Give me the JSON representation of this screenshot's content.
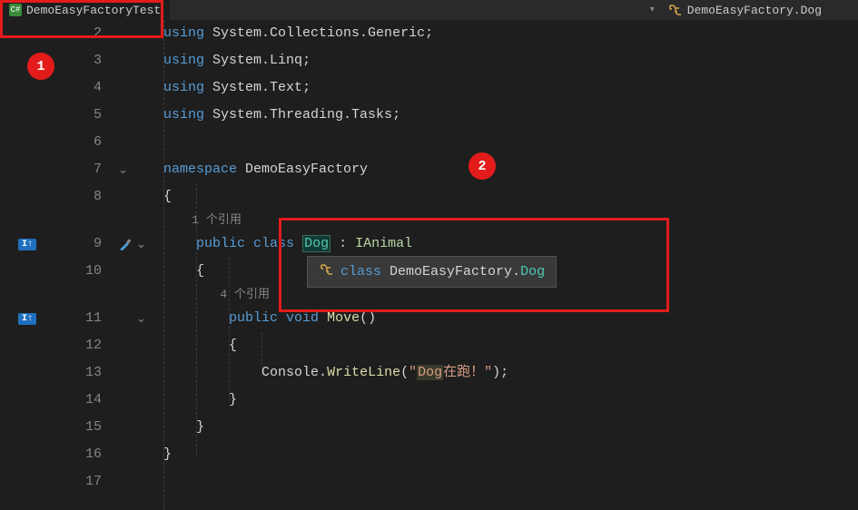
{
  "tab": {
    "icon_text": "C#",
    "title": "DemoEasyFactoryTest"
  },
  "breadcrumb": {
    "text": "DemoEasyFactory.Dog"
  },
  "line_numbers": [
    "2",
    "3",
    "4",
    "5",
    "6",
    "7",
    "8",
    "",
    "9",
    "10",
    "",
    "11",
    "12",
    "13",
    "14",
    "15",
    "16",
    "17"
  ],
  "code": {
    "using_kw": "using",
    "ns1": "System.Collections.Generic",
    "ns2": "System.Linq",
    "ns3": "System.Text",
    "ns4": "System.Threading.Tasks",
    "namespace_kw": "namespace",
    "namespace_name": "DemoEasyFactory",
    "ref1": "1 个引用",
    "public_kw": "public",
    "class_kw": "class",
    "class_name": "Dog",
    "iface_name": "IAnimal",
    "ref2": "4 个引用",
    "void_kw": "void",
    "method_name": "Move",
    "console": "Console",
    "writeline": "WriteLine",
    "str_open": "\"",
    "str_hl": "Dog",
    "str_rest": "在跑！\"",
    "semicolon": ";",
    "colon": ":",
    "open_brace": "{",
    "close_brace": "}",
    "parens": "()",
    "dot": "."
  },
  "tooltip": {
    "class_kw": "class",
    "ns": "DemoEasyFactory",
    "dot": ".",
    "cls": "Dog"
  },
  "annotations": {
    "a1": "1",
    "a2": "2"
  },
  "margin_badge": "I↑"
}
